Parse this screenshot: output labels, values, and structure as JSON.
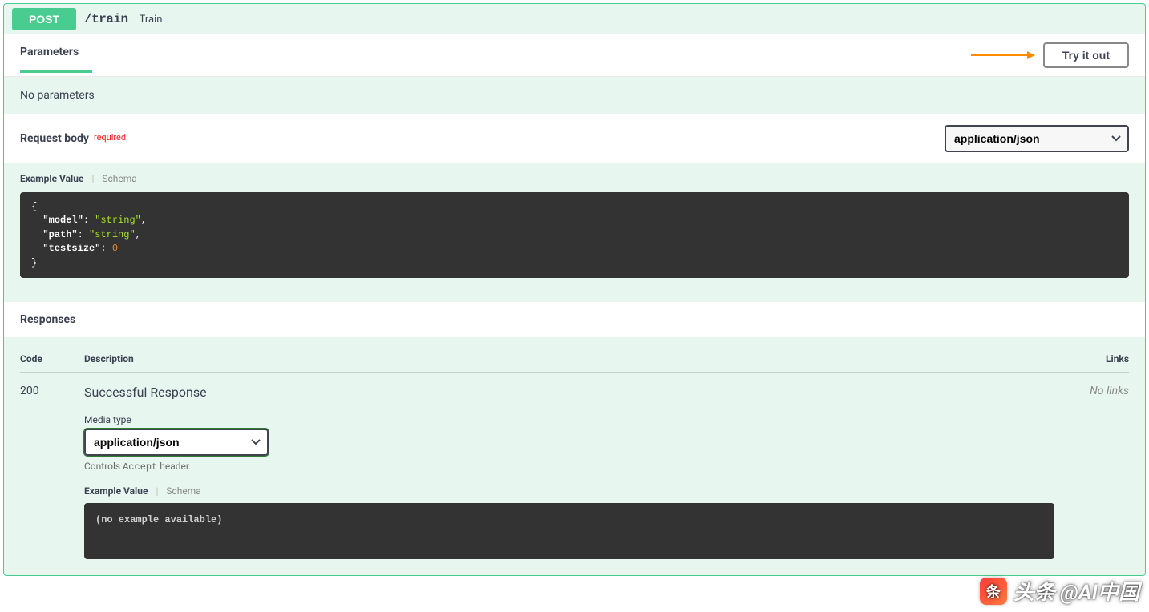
{
  "operation": {
    "method": "POST",
    "path": "/train",
    "summary": "Train"
  },
  "sections": {
    "parameters_title": "Parameters",
    "no_parameters": "No parameters",
    "request_body_title": "Request body",
    "required_label": "required",
    "responses_title": "Responses"
  },
  "buttons": {
    "try_it_out": "Try it out"
  },
  "content_type": {
    "selected": "application/json"
  },
  "tabs": {
    "example_value": "Example Value",
    "schema": "Schema"
  },
  "request_example": {
    "lines": [
      {
        "type": "brace",
        "text": "{"
      },
      {
        "type": "kv",
        "key": "\"model\"",
        "sep": ": ",
        "value": "\"string\"",
        "vclass": "str",
        "trail": ","
      },
      {
        "type": "kv",
        "key": "\"path\"",
        "sep": ": ",
        "value": "\"string\"",
        "vclass": "str",
        "trail": ","
      },
      {
        "type": "kv",
        "key": "\"testsize\"",
        "sep": ": ",
        "value": "0",
        "vclass": "num",
        "trail": ""
      },
      {
        "type": "brace",
        "text": "}"
      }
    ]
  },
  "responses": {
    "headers": {
      "code": "Code",
      "description": "Description",
      "links": "Links"
    },
    "rows": [
      {
        "code": "200",
        "description": "Successful Response",
        "links": "No links",
        "media_type_label": "Media type",
        "media_type": "application/json",
        "accept_hint_prefix": "Controls ",
        "accept_hint_kw": "Accept",
        "accept_hint_suffix": " header.",
        "example_text": "(no example available)"
      }
    ]
  },
  "watermark": "头条 @AI中国"
}
